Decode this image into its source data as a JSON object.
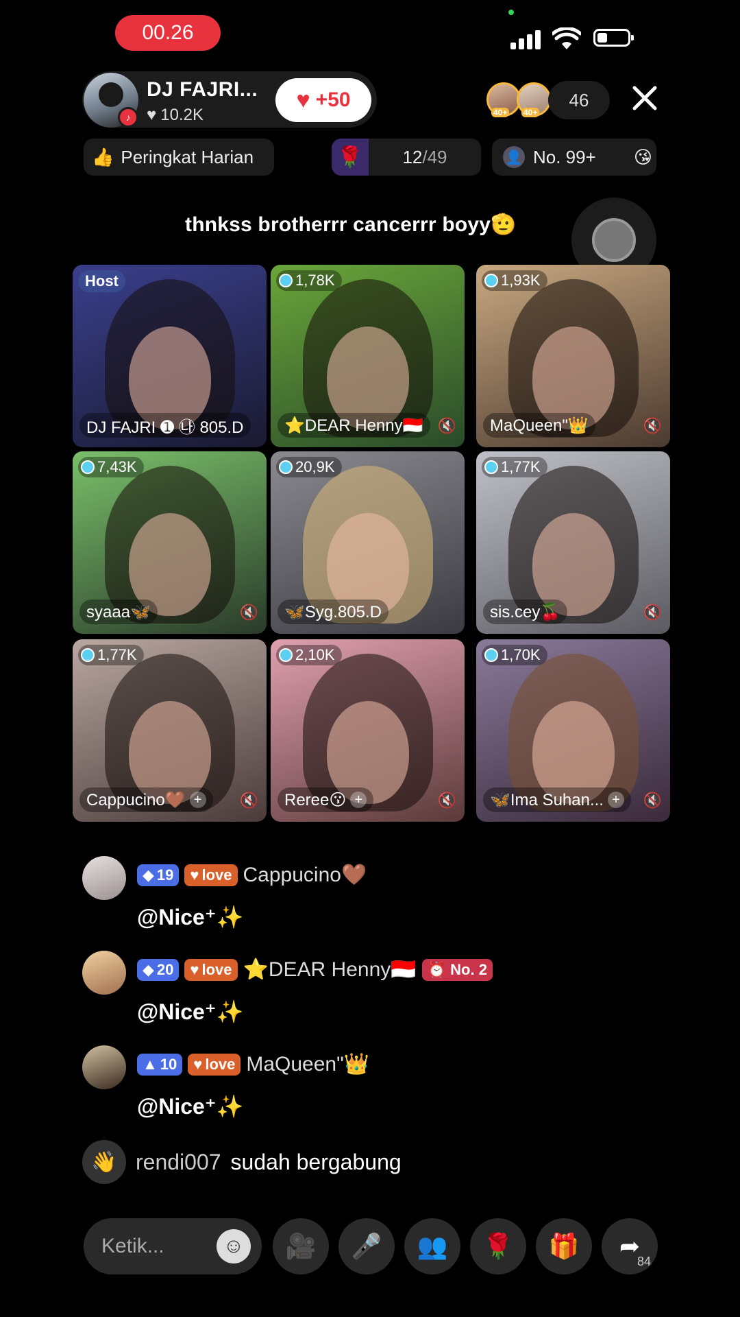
{
  "status": {
    "time": "00.26"
  },
  "host": {
    "name": "DJ FAJRI...",
    "likes": "10.2K",
    "like_bonus": "+50"
  },
  "viewers": {
    "badges": [
      "40+",
      "40+"
    ],
    "count": "46"
  },
  "stats": {
    "ranking_label": "Peringkat Harian",
    "rose_current": "12",
    "rose_total": "/49",
    "rank_label": "No. 99+"
  },
  "banner": "thnkss brotherrr cancerrr boyy🫡",
  "grid": [
    {
      "label": "Host",
      "name": "DJ FAJRI ➊ ㉯ 805.D",
      "bg": "#2a2f5c"
    },
    {
      "score": "1,78K",
      "name": "⭐DEAR Henny🇮🇩",
      "bg": "#5a8a3a"
    },
    {
      "score": "1,93K",
      "name": "MaQueen\"👑",
      "bg": "#8a7a6a"
    },
    {
      "score": "7,43K",
      "name": "syaaa🦋",
      "bg": "#4a7a4a"
    },
    {
      "score": "20,9K",
      "name": "🦋Syg.805.D",
      "bg": "#6a6a70"
    },
    {
      "score": "1,77K",
      "name": "sis.cey🍒",
      "bg": "#8a8a90"
    },
    {
      "score": "1,77K",
      "name": "Cappucino🤎",
      "bg": "#6a5a5a"
    },
    {
      "score": "2,10K",
      "name": "Reree😗",
      "bg": "#8a6a6a"
    },
    {
      "score": "1,70K",
      "name": "🦋Ima Suhan...",
      "bg": "#5a4a5a"
    }
  ],
  "comments": [
    {
      "level": "19",
      "love": "love",
      "user": "Cappucino🤎",
      "msg": "@Nice⁺✨"
    },
    {
      "level": "20",
      "love": "love",
      "user": "⭐DEAR Henny🇮🇩",
      "rank": "No. 2",
      "msg": "@Nice⁺✨"
    },
    {
      "level": "10",
      "love": "love",
      "user": "MaQueen\"👑",
      "msg": "@Nice⁺✨"
    }
  ],
  "join": {
    "user": "rendi007",
    "text": "sudah bergabung"
  },
  "bottom": {
    "placeholder": "Ketik...",
    "share_count": "84"
  }
}
